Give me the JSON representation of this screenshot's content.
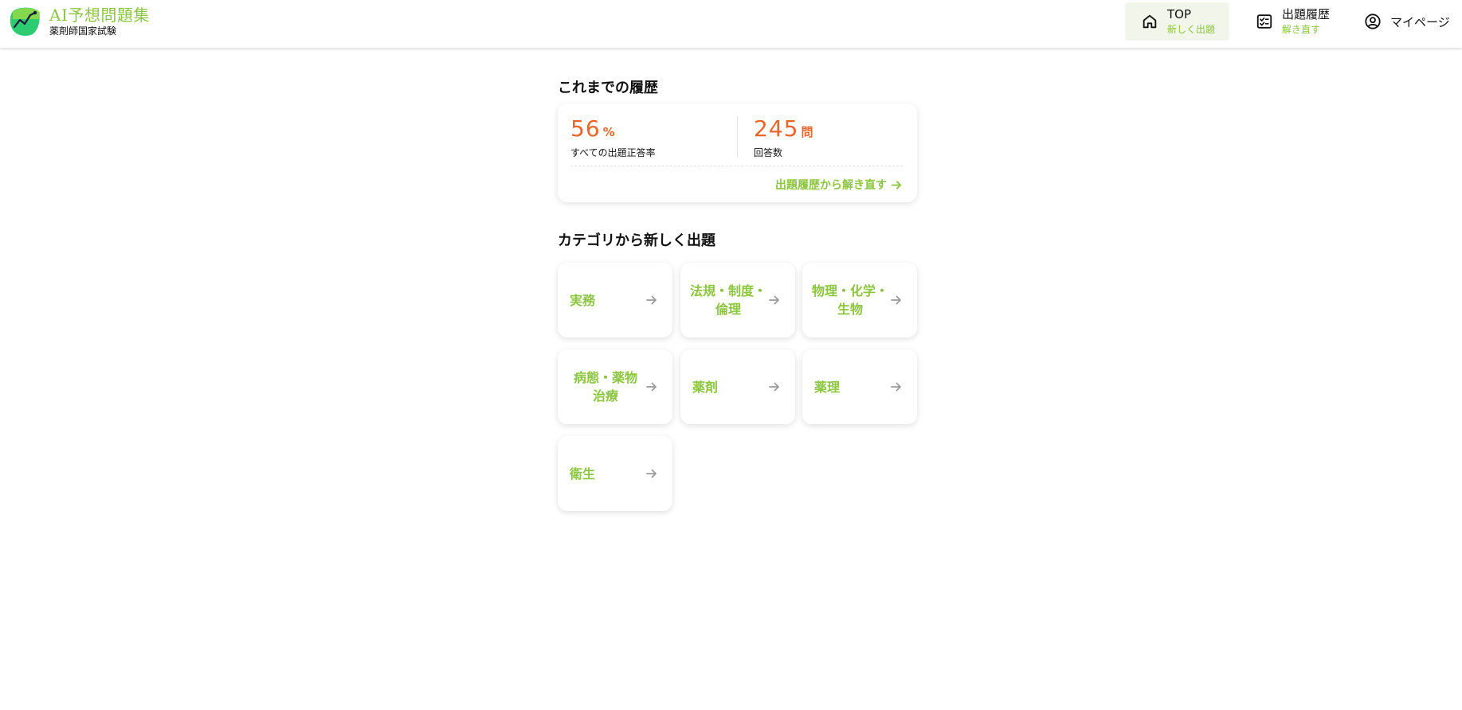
{
  "header": {
    "logo_title": "AI予想問題集",
    "logo_subtitle": "薬剤師国家試験",
    "nav": {
      "top_label": "TOP",
      "top_sub": "新しく出題",
      "history_label": "出題履歴",
      "history_sub": "解き直す",
      "mypage_label": "マイページ"
    }
  },
  "history": {
    "title": "これまでの履歴",
    "rate_value": "56",
    "rate_unit": "%",
    "rate_label": "すべての出題正答率",
    "count_value": "245",
    "count_unit": "問",
    "count_label": "回答数",
    "retry_link": "出題履歴から解き直す"
  },
  "categories": {
    "title": "カテゴリから新しく出題",
    "items": [
      {
        "label": "実務"
      },
      {
        "label": "法規・制度・\n倫理"
      },
      {
        "label": "物理・化学・\n生物"
      },
      {
        "label": "病態・薬物\n治療"
      },
      {
        "label": "薬剤"
      },
      {
        "label": "薬理"
      },
      {
        "label": "衛生"
      }
    ]
  },
  "colors": {
    "accent_green": "#8cc63f",
    "stat_orange": "#e8662a",
    "active_nav_bg": "#f1f5ea"
  },
  "icons": {
    "logo": "chart-leaf-logo",
    "top": "home-icon",
    "history": "checklist-icon",
    "mypage": "user-circle-icon",
    "arrow": "arrow-right-icon"
  }
}
